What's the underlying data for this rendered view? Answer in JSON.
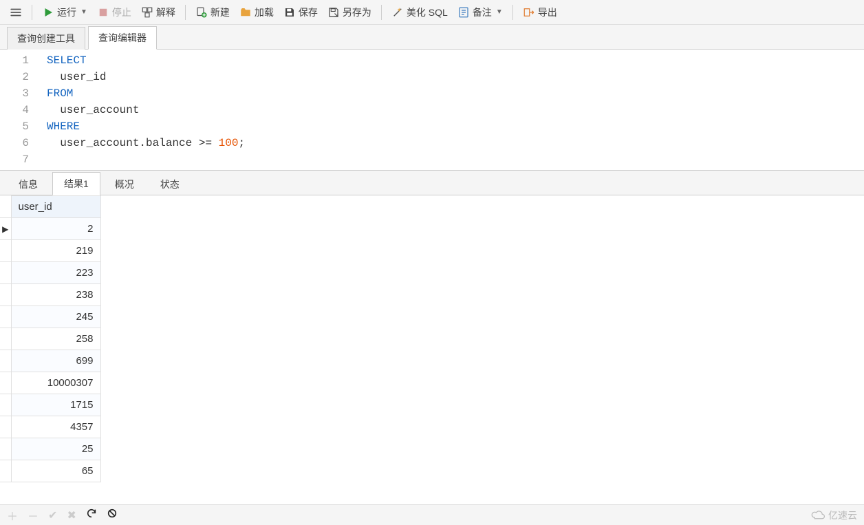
{
  "toolbar": {
    "run": "运行",
    "stop": "停止",
    "explain": "解释",
    "new": "新建",
    "load": "加载",
    "save": "保存",
    "save_as": "另存为",
    "beautify": "美化 SQL",
    "notes": "备注",
    "export": "导出"
  },
  "upper_tabs": {
    "builder": "查询创建工具",
    "editor": "查询编辑器"
  },
  "sql": {
    "line_count": 7,
    "tokens": [
      {
        "t": "kw",
        "v": "SELECT"
      },
      {
        "t": "nl"
      },
      {
        "t": "id",
        "v": "  user_id"
      },
      {
        "t": "nl"
      },
      {
        "t": "kw",
        "v": "FROM"
      },
      {
        "t": "nl"
      },
      {
        "t": "id",
        "v": "  user_account"
      },
      {
        "t": "nl"
      },
      {
        "t": "kw",
        "v": "WHERE"
      },
      {
        "t": "nl"
      },
      {
        "t": "id",
        "v": "  user_account.balance >= "
      },
      {
        "t": "num",
        "v": "100"
      },
      {
        "t": "id",
        "v": ";"
      }
    ]
  },
  "result_tabs": {
    "info": "信息",
    "result1": "结果1",
    "profile": "概况",
    "status": "状态"
  },
  "grid": {
    "columns": [
      "user_id"
    ],
    "rows": [
      [
        2
      ],
      [
        219
      ],
      [
        223
      ],
      [
        238
      ],
      [
        245
      ],
      [
        258
      ],
      [
        699
      ],
      [
        10000307
      ],
      [
        1715
      ],
      [
        4357
      ],
      [
        25
      ],
      [
        65
      ]
    ],
    "current_row_index": 0
  },
  "watermark": "亿速云"
}
